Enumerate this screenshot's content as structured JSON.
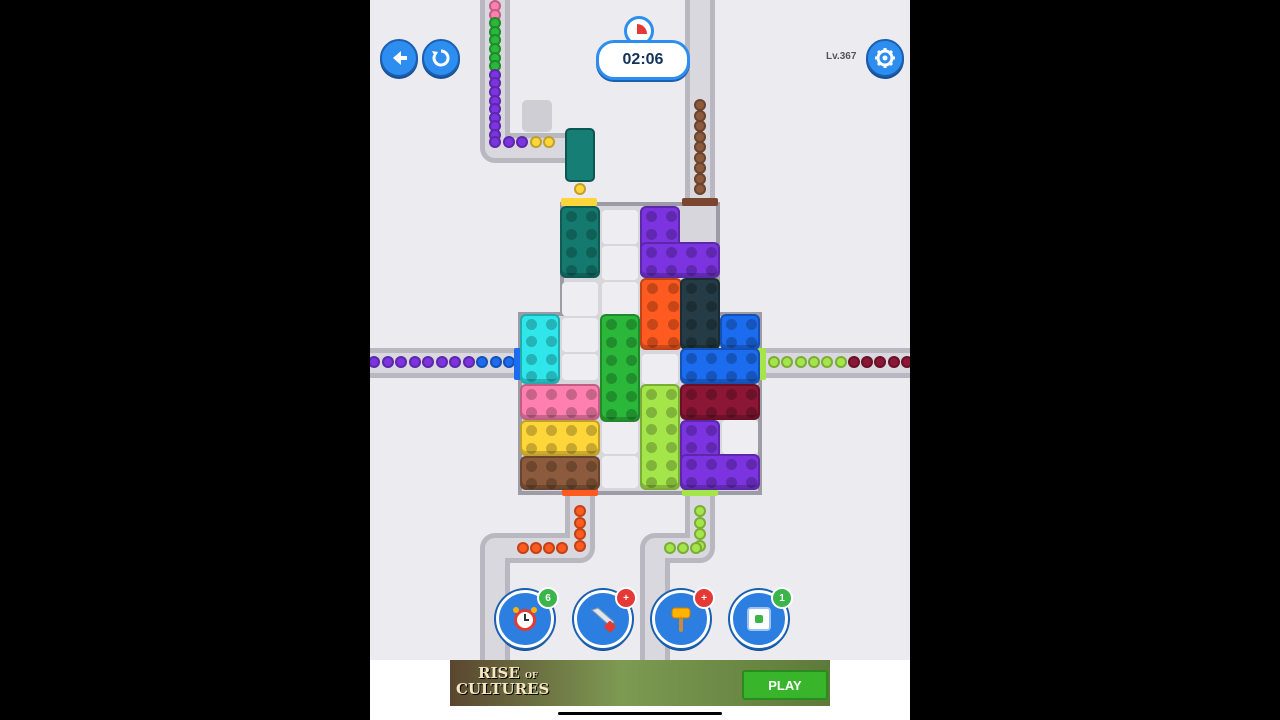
{
  "header": {
    "back_icon": "arrow-left-icon",
    "restart_icon": "restart-icon",
    "timer_icon": "stopwatch-icon",
    "timer": "02:06",
    "level": "Lv.367",
    "settings_icon": "gear-icon"
  },
  "boosters": [
    {
      "name": "time-freeze",
      "icon": "alarm-clock-icon",
      "badge": "6",
      "badge_color": "#39b54a"
    },
    {
      "name": "saw",
      "icon": "saw-icon",
      "badge": "+",
      "badge_color": "#e53935"
    },
    {
      "name": "hammer",
      "icon": "hammer-icon",
      "badge": "+",
      "badge_color": "#e53935"
    },
    {
      "name": "shrink",
      "icon": "shrink-icon",
      "badge": "1",
      "badge_color": "#39b54a"
    }
  ],
  "ad": {
    "title_line1": "RISE",
    "title_of": "OF",
    "title_line2": "CULTURES",
    "play_label": "PLAY"
  },
  "colors": {
    "purple": "#7b34e0",
    "teal": "#147a70",
    "orange": "#ff5a1f",
    "dark": "#253b45",
    "blue": "#1c6cf0",
    "cyan": "#2fe6ea",
    "green": "#2ab73a",
    "lime": "#a4e64a",
    "maroon": "#8b1636",
    "pink": "#ff7fb0",
    "yellow": "#ffd63a",
    "brown": "#8c5a3c"
  }
}
